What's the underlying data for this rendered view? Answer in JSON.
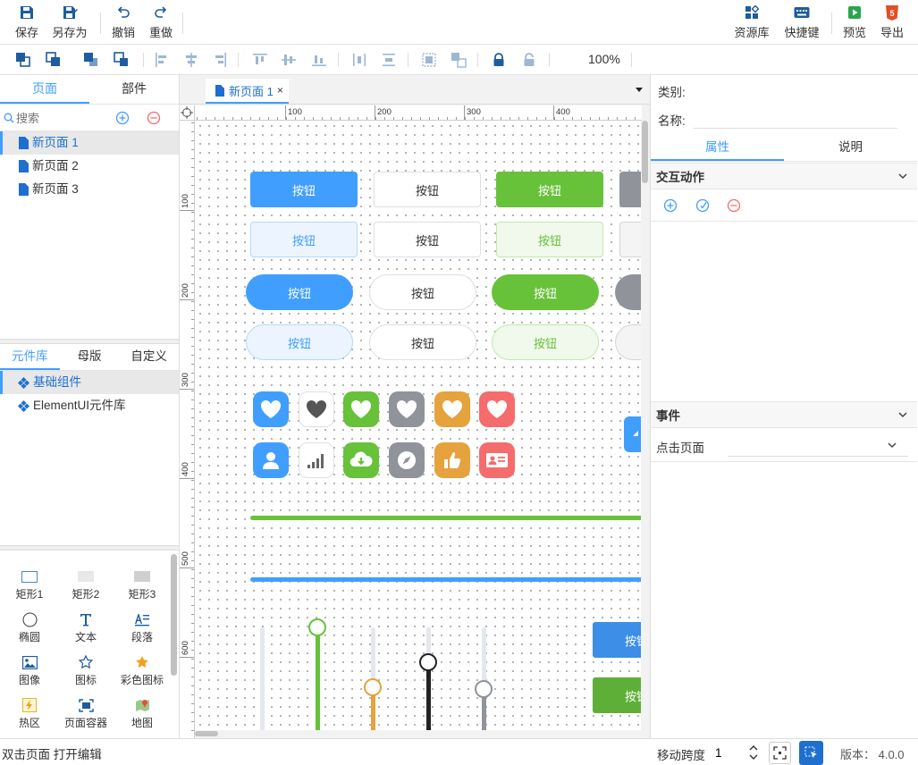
{
  "toolbar": {
    "save": "保存",
    "save_as": "另存为",
    "undo": "撤销",
    "redo": "重做",
    "resources": "资源库",
    "shortcuts": "快捷键",
    "preview": "预览",
    "export": "导出"
  },
  "alignbar": {
    "zoom": "100%"
  },
  "left": {
    "tabs": [
      "页面",
      "部件"
    ],
    "search_placeholder": "搜索",
    "pages": [
      "新页面 1",
      "新页面 2",
      "新页面 3"
    ],
    "lib_tabs": [
      "元件库",
      "母版",
      "自定义"
    ],
    "libs": [
      "基础组件",
      "ElementUI元件库"
    ],
    "components": [
      "矩形1",
      "矩形2",
      "矩形3",
      "椭圆",
      "文本",
      "段落",
      "图像",
      "图标",
      "彩色图标",
      "热区",
      "页面容器",
      "地图"
    ]
  },
  "canvas": {
    "tab_title": "新页面 1",
    "tab_close": "×",
    "ruler_x": [
      "100",
      "200",
      "300",
      "400"
    ],
    "ruler_y": [
      "100",
      "200",
      "300",
      "400",
      "500",
      "600"
    ],
    "button_label": "按钮",
    "button_label_cut": "按钮"
  },
  "right": {
    "category_label": "类别:",
    "name_label": "名称:",
    "tabs": [
      "属性",
      "说明"
    ],
    "interaction_title": "交互动作",
    "event_title": "事件",
    "event_select": "点击页面"
  },
  "status": {
    "hint": "双击页面 打开编辑",
    "step_label": "移动跨度",
    "step_value": "1",
    "version": "版本： 4.0.0"
  },
  "colors": {
    "primary": "#409eff",
    "success": "#67c23a",
    "info": "#909399",
    "warning": "#e6a23c",
    "danger": "#f56c6c"
  }
}
